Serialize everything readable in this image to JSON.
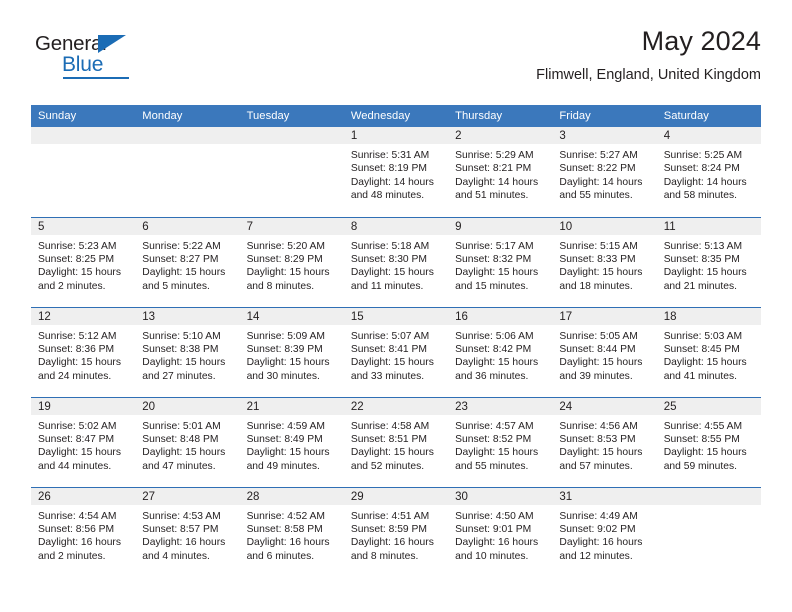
{
  "logo": {
    "word_top": "General",
    "word_bottom": "Blue",
    "accent_color": "#1b6cb5",
    "triangle_icon": "triangle-icon"
  },
  "header": {
    "title": "May 2024",
    "subtitle": "Flimwell, England, United Kingdom"
  },
  "theme": {
    "header_bg": "#3b78bc",
    "row_divider": "#2f6fb5",
    "daynum_bg": "#efefef",
    "text": "#231f20"
  },
  "calendar": {
    "weekday_headers": [
      "Sunday",
      "Monday",
      "Tuesday",
      "Wednesday",
      "Thursday",
      "Friday",
      "Saturday"
    ],
    "weeks": [
      [
        {
          "day": "",
          "sunrise": "",
          "sunset": "",
          "daylight1": "",
          "daylight2": "",
          "empty": true
        },
        {
          "day": "",
          "sunrise": "",
          "sunset": "",
          "daylight1": "",
          "daylight2": "",
          "empty": true
        },
        {
          "day": "",
          "sunrise": "",
          "sunset": "",
          "daylight1": "",
          "daylight2": "",
          "empty": true
        },
        {
          "day": "1",
          "sunrise": "Sunrise: 5:31 AM",
          "sunset": "Sunset: 8:19 PM",
          "daylight1": "Daylight: 14 hours",
          "daylight2": "and 48 minutes."
        },
        {
          "day": "2",
          "sunrise": "Sunrise: 5:29 AM",
          "sunset": "Sunset: 8:21 PM",
          "daylight1": "Daylight: 14 hours",
          "daylight2": "and 51 minutes."
        },
        {
          "day": "3",
          "sunrise": "Sunrise: 5:27 AM",
          "sunset": "Sunset: 8:22 PM",
          "daylight1": "Daylight: 14 hours",
          "daylight2": "and 55 minutes."
        },
        {
          "day": "4",
          "sunrise": "Sunrise: 5:25 AM",
          "sunset": "Sunset: 8:24 PM",
          "daylight1": "Daylight: 14 hours",
          "daylight2": "and 58 minutes."
        }
      ],
      [
        {
          "day": "5",
          "sunrise": "Sunrise: 5:23 AM",
          "sunset": "Sunset: 8:25 PM",
          "daylight1": "Daylight: 15 hours",
          "daylight2": "and 2 minutes."
        },
        {
          "day": "6",
          "sunrise": "Sunrise: 5:22 AM",
          "sunset": "Sunset: 8:27 PM",
          "daylight1": "Daylight: 15 hours",
          "daylight2": "and 5 minutes."
        },
        {
          "day": "7",
          "sunrise": "Sunrise: 5:20 AM",
          "sunset": "Sunset: 8:29 PM",
          "daylight1": "Daylight: 15 hours",
          "daylight2": "and 8 minutes."
        },
        {
          "day": "8",
          "sunrise": "Sunrise: 5:18 AM",
          "sunset": "Sunset: 8:30 PM",
          "daylight1": "Daylight: 15 hours",
          "daylight2": "and 11 minutes."
        },
        {
          "day": "9",
          "sunrise": "Sunrise: 5:17 AM",
          "sunset": "Sunset: 8:32 PM",
          "daylight1": "Daylight: 15 hours",
          "daylight2": "and 15 minutes."
        },
        {
          "day": "10",
          "sunrise": "Sunrise: 5:15 AM",
          "sunset": "Sunset: 8:33 PM",
          "daylight1": "Daylight: 15 hours",
          "daylight2": "and 18 minutes."
        },
        {
          "day": "11",
          "sunrise": "Sunrise: 5:13 AM",
          "sunset": "Sunset: 8:35 PM",
          "daylight1": "Daylight: 15 hours",
          "daylight2": "and 21 minutes."
        }
      ],
      [
        {
          "day": "12",
          "sunrise": "Sunrise: 5:12 AM",
          "sunset": "Sunset: 8:36 PM",
          "daylight1": "Daylight: 15 hours",
          "daylight2": "and 24 minutes."
        },
        {
          "day": "13",
          "sunrise": "Sunrise: 5:10 AM",
          "sunset": "Sunset: 8:38 PM",
          "daylight1": "Daylight: 15 hours",
          "daylight2": "and 27 minutes."
        },
        {
          "day": "14",
          "sunrise": "Sunrise: 5:09 AM",
          "sunset": "Sunset: 8:39 PM",
          "daylight1": "Daylight: 15 hours",
          "daylight2": "and 30 minutes."
        },
        {
          "day": "15",
          "sunrise": "Sunrise: 5:07 AM",
          "sunset": "Sunset: 8:41 PM",
          "daylight1": "Daylight: 15 hours",
          "daylight2": "and 33 minutes."
        },
        {
          "day": "16",
          "sunrise": "Sunrise: 5:06 AM",
          "sunset": "Sunset: 8:42 PM",
          "daylight1": "Daylight: 15 hours",
          "daylight2": "and 36 minutes."
        },
        {
          "day": "17",
          "sunrise": "Sunrise: 5:05 AM",
          "sunset": "Sunset: 8:44 PM",
          "daylight1": "Daylight: 15 hours",
          "daylight2": "and 39 minutes."
        },
        {
          "day": "18",
          "sunrise": "Sunrise: 5:03 AM",
          "sunset": "Sunset: 8:45 PM",
          "daylight1": "Daylight: 15 hours",
          "daylight2": "and 41 minutes."
        }
      ],
      [
        {
          "day": "19",
          "sunrise": "Sunrise: 5:02 AM",
          "sunset": "Sunset: 8:47 PM",
          "daylight1": "Daylight: 15 hours",
          "daylight2": "and 44 minutes."
        },
        {
          "day": "20",
          "sunrise": "Sunrise: 5:01 AM",
          "sunset": "Sunset: 8:48 PM",
          "daylight1": "Daylight: 15 hours",
          "daylight2": "and 47 minutes."
        },
        {
          "day": "21",
          "sunrise": "Sunrise: 4:59 AM",
          "sunset": "Sunset: 8:49 PM",
          "daylight1": "Daylight: 15 hours",
          "daylight2": "and 49 minutes."
        },
        {
          "day": "22",
          "sunrise": "Sunrise: 4:58 AM",
          "sunset": "Sunset: 8:51 PM",
          "daylight1": "Daylight: 15 hours",
          "daylight2": "and 52 minutes."
        },
        {
          "day": "23",
          "sunrise": "Sunrise: 4:57 AM",
          "sunset": "Sunset: 8:52 PM",
          "daylight1": "Daylight: 15 hours",
          "daylight2": "and 55 minutes."
        },
        {
          "day": "24",
          "sunrise": "Sunrise: 4:56 AM",
          "sunset": "Sunset: 8:53 PM",
          "daylight1": "Daylight: 15 hours",
          "daylight2": "and 57 minutes."
        },
        {
          "day": "25",
          "sunrise": "Sunrise: 4:55 AM",
          "sunset": "Sunset: 8:55 PM",
          "daylight1": "Daylight: 15 hours",
          "daylight2": "and 59 minutes."
        }
      ],
      [
        {
          "day": "26",
          "sunrise": "Sunrise: 4:54 AM",
          "sunset": "Sunset: 8:56 PM",
          "daylight1": "Daylight: 16 hours",
          "daylight2": "and 2 minutes."
        },
        {
          "day": "27",
          "sunrise": "Sunrise: 4:53 AM",
          "sunset": "Sunset: 8:57 PM",
          "daylight1": "Daylight: 16 hours",
          "daylight2": "and 4 minutes."
        },
        {
          "day": "28",
          "sunrise": "Sunrise: 4:52 AM",
          "sunset": "Sunset: 8:58 PM",
          "daylight1": "Daylight: 16 hours",
          "daylight2": "and 6 minutes."
        },
        {
          "day": "29",
          "sunrise": "Sunrise: 4:51 AM",
          "sunset": "Sunset: 8:59 PM",
          "daylight1": "Daylight: 16 hours",
          "daylight2": "and 8 minutes."
        },
        {
          "day": "30",
          "sunrise": "Sunrise: 4:50 AM",
          "sunset": "Sunset: 9:01 PM",
          "daylight1": "Daylight: 16 hours",
          "daylight2": "and 10 minutes."
        },
        {
          "day": "31",
          "sunrise": "Sunrise: 4:49 AM",
          "sunset": "Sunset: 9:02 PM",
          "daylight1": "Daylight: 16 hours",
          "daylight2": "and 12 minutes."
        },
        {
          "day": "",
          "sunrise": "",
          "sunset": "",
          "daylight1": "",
          "daylight2": "",
          "empty": true
        }
      ]
    ]
  }
}
